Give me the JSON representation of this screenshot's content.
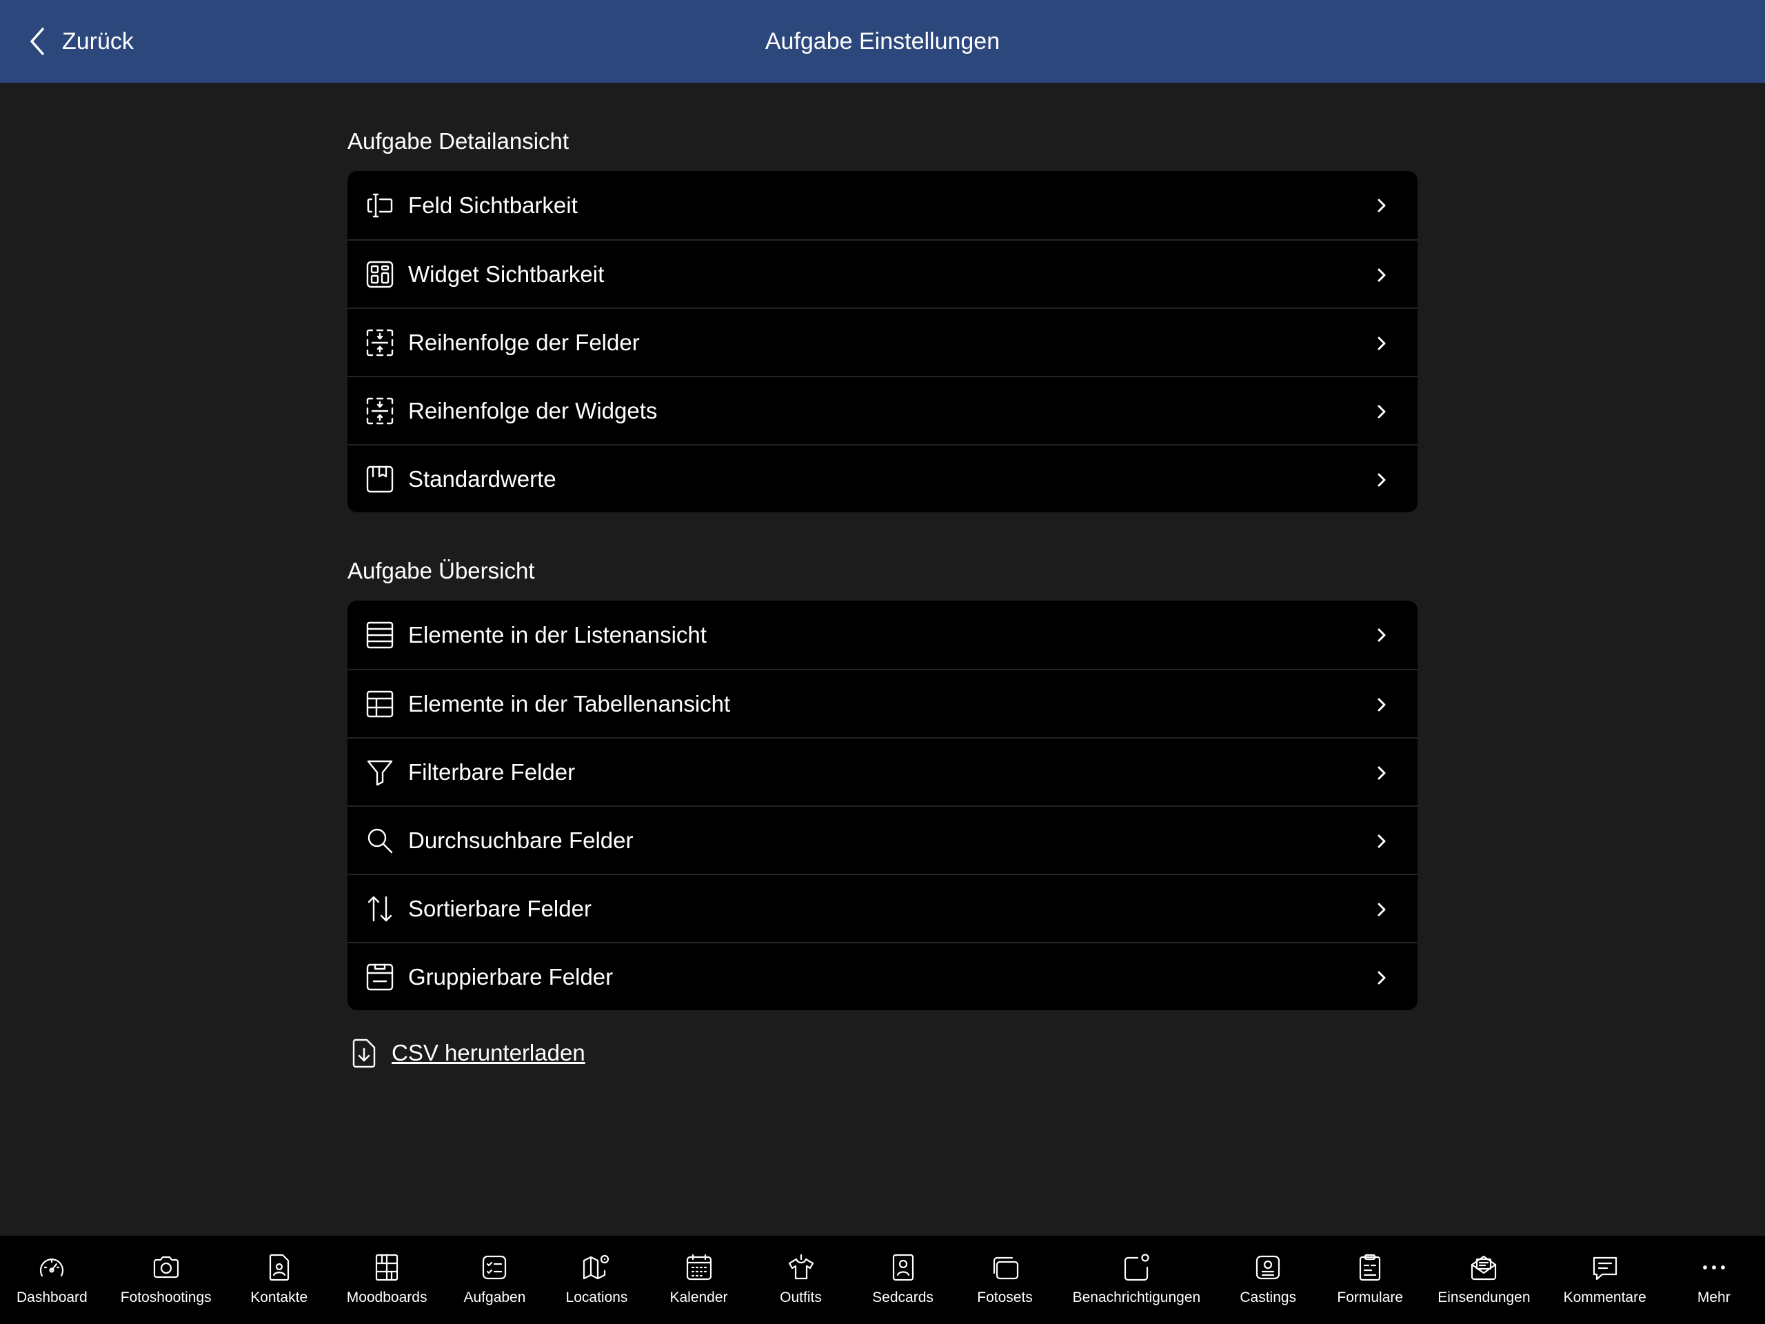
{
  "nav": {
    "back_label": "Zurück",
    "title": "Aufgabe Einstellungen"
  },
  "sections": [
    {
      "title": "Aufgabe Detailansicht",
      "items": [
        {
          "label": "Feld Sichtbarkeit",
          "icon": "field-visibility-icon"
        },
        {
          "label": "Widget Sichtbarkeit",
          "icon": "widget-grid-icon"
        },
        {
          "label": "Reihenfolge der Felder",
          "icon": "reorder-fields-icon"
        },
        {
          "label": "Reihenfolge der Widgets",
          "icon": "reorder-widgets-icon"
        },
        {
          "label": "Standardwerte",
          "icon": "default-values-icon"
        }
      ]
    },
    {
      "title": "Aufgabe Übersicht",
      "items": [
        {
          "label": "Elemente in der Listenansicht",
          "icon": "list-view-icon"
        },
        {
          "label": "Elemente in der Tabellenansicht",
          "icon": "table-view-icon"
        },
        {
          "label": "Filterbare Felder",
          "icon": "filter-icon"
        },
        {
          "label": "Durchsuchbare Felder",
          "icon": "search-icon"
        },
        {
          "label": "Sortierbare Felder",
          "icon": "sort-icon"
        },
        {
          "label": "Gruppierbare Felder",
          "icon": "group-icon"
        }
      ]
    }
  ],
  "csv_label": "CSV herunterladen",
  "tabs": [
    {
      "label": "Dashboard",
      "icon": "speedometer-icon"
    },
    {
      "label": "Fotoshootings",
      "icon": "camera-icon"
    },
    {
      "label": "Kontakte",
      "icon": "contact-icon"
    },
    {
      "label": "Moodboards",
      "icon": "moodboard-icon"
    },
    {
      "label": "Aufgaben",
      "icon": "tasks-icon"
    },
    {
      "label": "Locations",
      "icon": "map-icon"
    },
    {
      "label": "Kalender",
      "icon": "calendar-icon"
    },
    {
      "label": "Outfits",
      "icon": "shirt-icon"
    },
    {
      "label": "Sedcards",
      "icon": "sedcard-icon"
    },
    {
      "label": "Fotosets",
      "icon": "photosets-icon"
    },
    {
      "label": "Benachrichtigungen",
      "icon": "notification-icon"
    },
    {
      "label": "Castings",
      "icon": "casting-icon"
    },
    {
      "label": "Formulare",
      "icon": "clipboard-icon"
    },
    {
      "label": "Einsendungen",
      "icon": "mail-icon"
    },
    {
      "label": "Kommentare",
      "icon": "comment-icon"
    },
    {
      "label": "Mehr",
      "icon": "more-icon"
    }
  ]
}
